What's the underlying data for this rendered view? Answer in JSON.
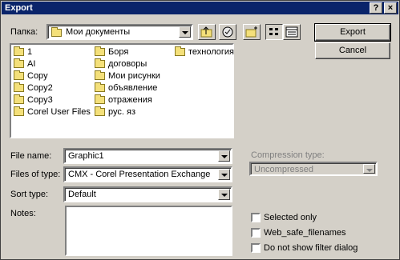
{
  "window": {
    "title": "Export",
    "help_glyph": "?",
    "close_glyph": "×"
  },
  "look_in": {
    "label": "Папка:",
    "value": "Мои документы"
  },
  "toolbar": {
    "icons": [
      "up-folder-icon",
      "desktop-icon",
      "new-folder-icon",
      "list-view-icon",
      "details-view-icon"
    ]
  },
  "files": {
    "col1": [
      "1",
      "AI",
      "Copy",
      "Copy2",
      "Copy3",
      "Corel User Files"
    ],
    "col2": [
      "Боря",
      "договоры",
      "Мои рисунки",
      "объявление",
      "отражения",
      "рус. яз"
    ],
    "col3": [
      "технология"
    ]
  },
  "buttons": {
    "export": "Export",
    "cancel": "Cancel"
  },
  "file_name": {
    "label": "File name:",
    "value": "Graphic1"
  },
  "file_type": {
    "label": "Files of type:",
    "value": "CMX - Corel Presentation Exchange"
  },
  "sort_type": {
    "label": "Sort type:",
    "value": "Default"
  },
  "compression": {
    "label": "Compression type:",
    "value": "Uncompressed"
  },
  "notes": {
    "label": "Notes:"
  },
  "options": {
    "selected_only": "Selected only",
    "web_safe": "Web_safe_filenames",
    "no_filter_dialog": "Do not show filter dialog"
  }
}
